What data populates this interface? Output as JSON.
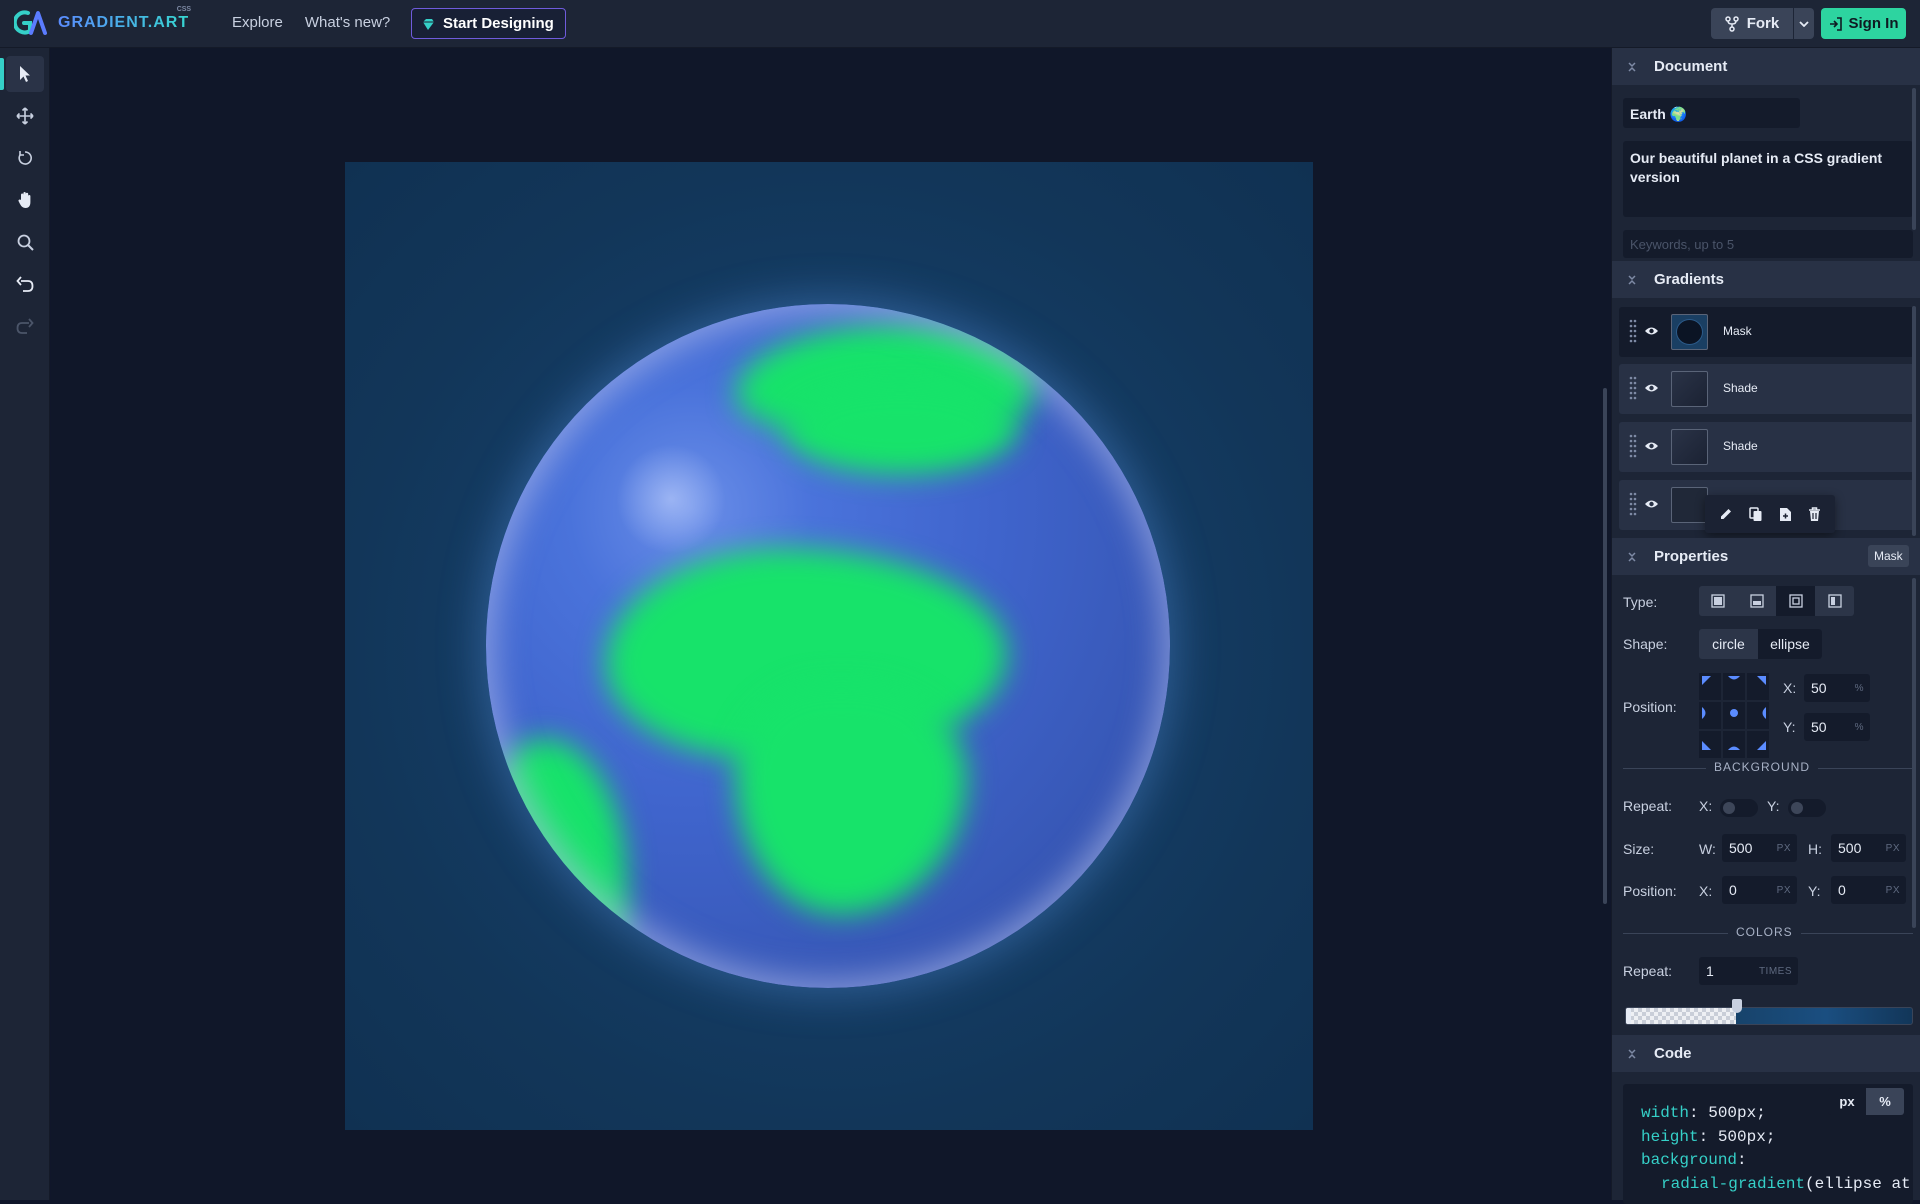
{
  "app": {
    "logo_text": "GRADIENT.ART",
    "logo_badge": "CSS"
  },
  "nav": {
    "explore": "Explore",
    "whats_new": "What's new?",
    "start_designing": "Start Designing"
  },
  "header_actions": {
    "fork": "Fork",
    "sign_in": "Sign In"
  },
  "tools": [
    "select",
    "move",
    "rotate",
    "hand",
    "zoom",
    "undo",
    "redo"
  ],
  "document": {
    "section_title": "Document",
    "name": "Earth 🌍",
    "description": "Our beautiful planet in a CSS gradient version",
    "keywords_placeholder": "Keywords, up to 5"
  },
  "gradients": {
    "section_title": "Gradients",
    "layers": [
      {
        "name": "Mask",
        "selected": true
      },
      {
        "name": "Shade",
        "selected": false
      },
      {
        "name": "Shade",
        "selected": false
      },
      {
        "name": "",
        "selected": false
      }
    ]
  },
  "properties": {
    "section_title": "Properties",
    "badge": "Mask",
    "type_label": "Type:",
    "shape_label": "Shape:",
    "shape_options": [
      "circle",
      "ellipse"
    ],
    "shape_selected": "ellipse",
    "position_label": "Position:",
    "pos_x_label": "X:",
    "pos_x": "50",
    "pos_y_label": "Y:",
    "pos_y": "50",
    "percent_unit": "%",
    "background_divider": "BACKGROUND",
    "repeat_label": "Repeat:",
    "repeat_x_label": "X:",
    "repeat_y_label": "Y:",
    "size_label": "Size:",
    "size_w_label": "W:",
    "size_w": "500",
    "size_h_label": "H:",
    "size_h": "500",
    "px_unit": "PX",
    "bg_position_label": "Position:",
    "bg_x_label": "X:",
    "bg_x": "0",
    "bg_y_label": "Y:",
    "bg_y": "0",
    "colors_divider": "COLORS",
    "colors_repeat_label": "Repeat:",
    "colors_repeat": "1",
    "times_unit": "TIMES"
  },
  "code": {
    "section_title": "Code",
    "unit_px": "px",
    "unit_percent": "%",
    "line1_key": "width",
    "line1_val": ": 500px;",
    "line2_key": "height",
    "line2_val": ": 500px;",
    "line3_key": "background",
    "line3_val": ":",
    "line4_fn": "radial-gradient",
    "line4_rest": "(ellipse at"
  },
  "colors": {
    "accent_teal": "#35d0c8",
    "signin_green": "#2dd4a0",
    "land_green": "#17e36a",
    "ocean_blue": "#3f64cc",
    "panel_bg": "#1d2536"
  }
}
